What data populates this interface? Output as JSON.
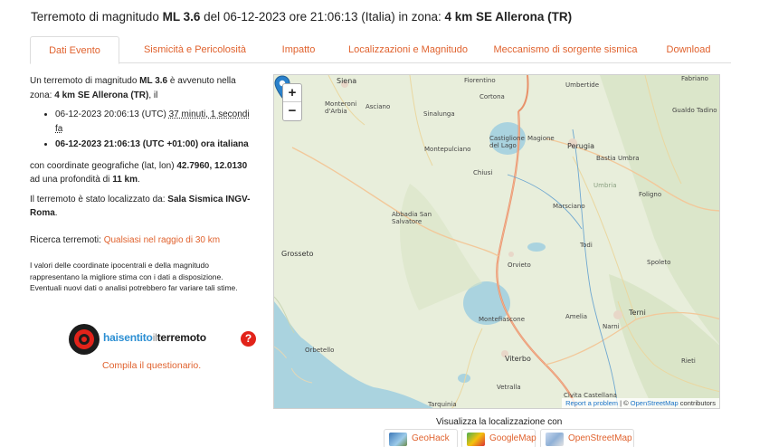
{
  "title": {
    "pre": "Terremoto di magnitudo ",
    "mag": "ML 3.6",
    "mid": " del 06-12-2023 ore 21:06:13 (Italia) in zona: ",
    "zone": "4 km SE Allerona (TR)"
  },
  "tabs": [
    {
      "label": "Dati Evento",
      "active": true
    },
    {
      "label": "Sismicità e Pericolosità"
    },
    {
      "label": "Impatto"
    },
    {
      "label": "Localizzazioni e Magnitudo"
    },
    {
      "label": "Meccanismo di sorgente sismica"
    },
    {
      "label": "Download"
    }
  ],
  "info": {
    "p1_a": "Un terremoto di magnitudo ",
    "p1_mag": "ML 3.6",
    "p1_b": " è avvenuto nella zona: ",
    "p1_zone": "4 km SE Allerona (TR)",
    "p1_c": ", il",
    "utc_time": "06-12-2023 20:06:13 (UTC) ",
    "ago": "37 minuti, 1 secondi fa",
    "local_time": "06-12-2023 21:06:13 (UTC +01:00) ora italiana",
    "coord_a": "con coordinate geografiche (lat, lon) ",
    "coords": "42.7960, 12.0130",
    "coord_b": " ad una profondità di ",
    "depth": "11 km",
    "coord_c": ".",
    "loc_a": "Il terremoto è stato localizzato da: ",
    "loc_by": "Sala Sismica INGV-Roma",
    "loc_c": ".",
    "search_a": "Ricerca terremoti: ",
    "search_link": "Qualsiasi nel raggio di 30 km",
    "disclaimer": "I valori delle coordinate ipocentrali e della magnitudo rappresentano la migliore stima con i dati a disposizione. Eventuali nuovi dati o analisi potrebbero far variare tali stime."
  },
  "hsit": {
    "part_a": "hai",
    "part_b": "sentito",
    "part_c": "il",
    "part_d": "terremoto",
    "question": "?",
    "cta": "Compila il questionario."
  },
  "map": {
    "zoom_in": "+",
    "zoom_out": "−",
    "attribution_a": "Report a problem",
    "attribution_sep": " | © ",
    "attribution_b": "OpenStreetMap",
    "attribution_c": " contributors",
    "places": [
      "Siena",
      "Fiorentino",
      "Umbertide",
      "Fabriano",
      "Monteroni d'Arbia",
      "Asciano",
      "Sinalunga",
      "Cortona",
      "Gualdo Tadino",
      "Castiglione del Lago",
      "Magione",
      "Perugia",
      "Montepulciano",
      "Bastia Umbra",
      "Chiusi",
      "Umbria",
      "Foligno",
      "Abbadia San Salvatore",
      "Marsciano",
      "Grosseto",
      "Todi",
      "Orvieto",
      "Spoleto",
      "Montefiascone",
      "Amelia",
      "Terni",
      "Narni",
      "Orbetello",
      "Viterbo",
      "Rieti",
      "Vetralla",
      "Civita Castellana",
      "Tarquinia"
    ]
  },
  "visualizza": {
    "label": "Visualizza la localizzazione con",
    "buttons": [
      "GeoHack",
      "GoogleMap",
      "OpenStreetMap"
    ]
  },
  "colors": {
    "accent": "#e0622e",
    "sea": "#aad3df",
    "land": "#e8eedb",
    "marker": "#2a81cb"
  }
}
